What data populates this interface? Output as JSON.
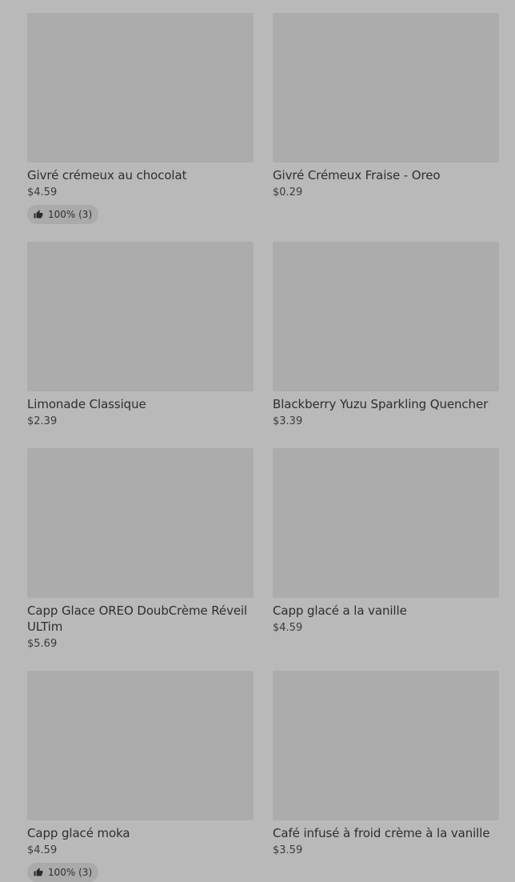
{
  "products": [
    {
      "name": "Givré crémeux au chocolat",
      "price": "$4.59",
      "rating": "100% (3)"
    },
    {
      "name": "Givré Crémeux Fraise - Oreo",
      "price": "$0.29"
    },
    {
      "name": "Limonade Classique",
      "price": "$2.39"
    },
    {
      "name": "Blackberry Yuzu Sparkling Quencher",
      "price": "$3.39"
    },
    {
      "name": "Capp Glace OREO DoubCrème Réveil ULTim",
      "price": "$5.69"
    },
    {
      "name": "Capp glacé a la vanille",
      "price": "$4.59"
    },
    {
      "name": "Capp glacé moka",
      "price": "$4.59",
      "rating": "100% (3)"
    },
    {
      "name": "Café infusé à froid crème à la vanille",
      "price": "$3.59"
    }
  ],
  "icons": {
    "rating": "thumbs-up-icon"
  },
  "colors": {
    "background": "#b9b9b9",
    "placeholder": "#acacac",
    "text": "#2e2e2e"
  }
}
